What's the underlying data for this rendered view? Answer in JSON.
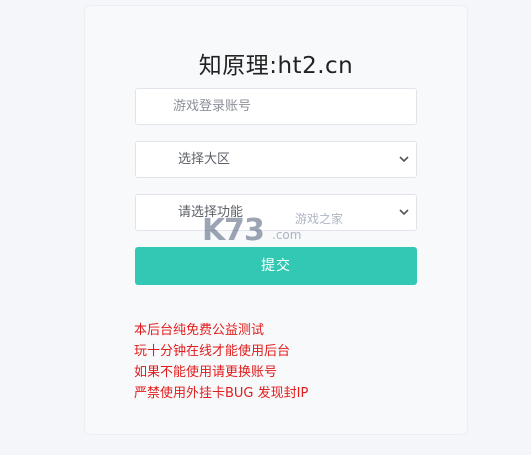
{
  "page_title": "知原理:ht2.cn",
  "form": {
    "account_placeholder": "游戏登录账号",
    "region_select": "选择大区",
    "function_select": "请选择功能",
    "submit_label": "提交"
  },
  "notes": [
    "本后台纯免费公益测试",
    "玩十分钟在线才能使用后台",
    "如果不能使用请更换账号",
    "严禁使用外挂卡BUG 发现封IP"
  ],
  "watermark": {
    "site_name": "游戏之家",
    "domain": ".com"
  },
  "colors": {
    "accent": "#33c8b3",
    "warning_text": "#e11c1c",
    "background": "#f4f6fa"
  }
}
